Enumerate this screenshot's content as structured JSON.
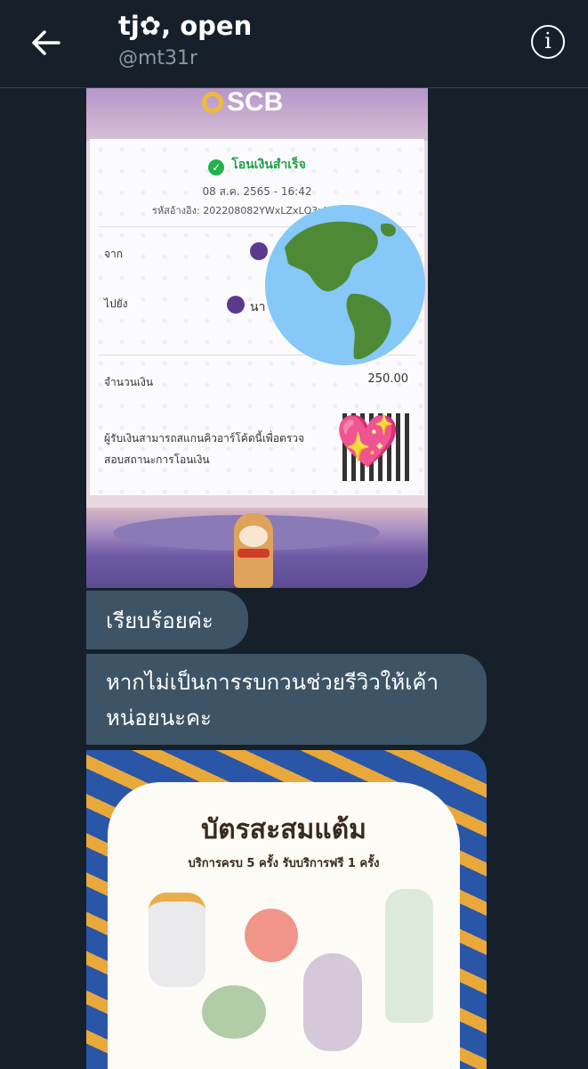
{
  "header": {
    "title": "tj✿, open",
    "handle": "@mt31r",
    "info_glyph": "i"
  },
  "receipt": {
    "brand": "SCB",
    "status": "โอนเงินสำเร็จ",
    "date": "08 ส.ค. 2565 - 16:42",
    "ref": "รหัสอ้างอิง: 202208082YWxLZxLQ3uW7",
    "from_label": "จาก",
    "to_label": "ไปยัง",
    "to_name": "นา",
    "amount_label": "จำนวนเงิน",
    "amount_value": "250.00",
    "qr_note": "ผู้รับเงินสามารถสแกนคิวอาร์โค้ดนี้เพื่อตรวจสอบสถานะการโอนเงิน"
  },
  "messages": [
    {
      "text": "เรียบร้อยค่ะ"
    },
    {
      "text": "หากไม่เป็นการรบกวนช่วยรีวิวให้เค้าหน่อยนะคะ"
    }
  ],
  "card": {
    "title": "บัตรสะสมแต้ม",
    "subtitle": "บริการครบ 5 ครั้ง รับบริการฟรี 1 ครั้ง"
  },
  "icons": {
    "back": "back-arrow-icon",
    "info": "info-icon",
    "check": "check-circle-icon",
    "globe": "globe-emoji",
    "heart": "sparkling-heart-emoji"
  },
  "colors": {
    "background": "#15202b",
    "bubble": "#3d5466",
    "muted_text": "#8899a6",
    "success_green": "#22b14c"
  }
}
